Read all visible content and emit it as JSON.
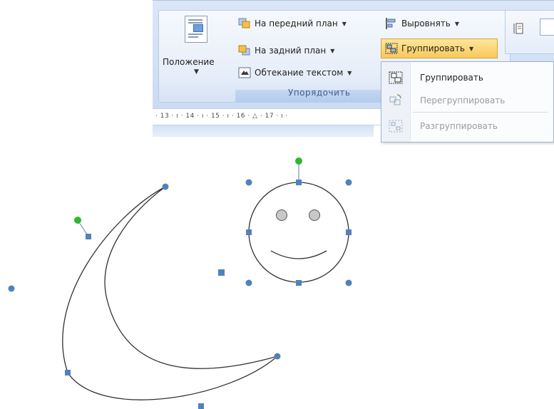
{
  "ribbon": {
    "position_label": "Положение",
    "bring_front_label": "На передний план",
    "send_back_label": "На задний план",
    "text_wrap_label": "Обтекание текстом",
    "align_label": "Выровнять",
    "group_label": "Группировать",
    "section_label": "Упорядочить"
  },
  "ruler": {
    "text": "· 13 · ı · 14 · ı · 15 · ı · 16 · △ · 17 · ı ·"
  },
  "menu": {
    "items": [
      {
        "label": "Группировать",
        "enabled": true
      },
      {
        "label": "Перегруппировать",
        "enabled": false
      },
      {
        "label": "Разгруппировать",
        "enabled": false
      }
    ]
  },
  "colors": {
    "ribbon_bg": "#dbe7f6",
    "highlight": "#f9c95b",
    "handle_blue": "#4f81bd",
    "rotate_green": "#2eb82e",
    "shape_fill": "#c8c8c8"
  },
  "icons": [
    "position-icon",
    "bring-forward-icon",
    "send-backward-icon",
    "text-wrap-icon",
    "align-icon",
    "group-icon",
    "regroup-icon",
    "ungroup-icon"
  ]
}
